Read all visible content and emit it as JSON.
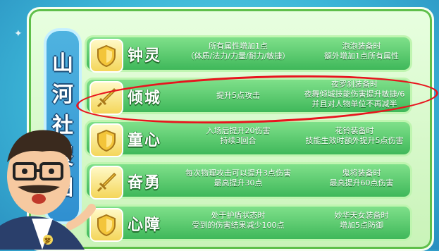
{
  "side_title": [
    "山",
    "河",
    "社",
    "稷",
    "图"
  ],
  "rows": [
    {
      "name": "钟灵",
      "icon": "shield-icon",
      "effect": [
        "所有属性增加1点",
        "（体质/法力/力量/耐力/敏捷）"
      ],
      "set_bonus": [
        "泡泡装备时",
        "额外增加1点所有属性"
      ]
    },
    {
      "name": "倾城",
      "icon": "sword-icon",
      "effect": [
        "提升5点攻击"
      ],
      "set_bonus": [
        "夜罗刹装备时",
        "夜舞倾城技能伤害提升敏捷/6",
        "并且对人物单位不再减半"
      ]
    },
    {
      "name": "童心",
      "icon": "shield-icon",
      "effect": [
        "入场后提升20伤害",
        "持续3回合"
      ],
      "set_bonus": [
        "花铃装备时",
        "技能生效时额外提升5点伤害"
      ]
    },
    {
      "name": "奋勇",
      "icon": "sword-icon",
      "effect": [
        "每次物理攻击可以提升3点伤害",
        "最高提升30点"
      ],
      "set_bonus": [
        "鬼将装备时",
        "最高提升60点伤害"
      ]
    },
    {
      "name": "心障",
      "icon": "shield-icon",
      "effect": [
        "处于护盾状态时",
        "受到的伤害结果减少100点"
      ],
      "set_bonus": [
        "妙华天女装备时",
        "增加5点防御"
      ]
    }
  ],
  "badge": "梦",
  "colors": {
    "panel": "#c9f3b8",
    "row": "#3fb85a",
    "highlight_ring": "#e8141e",
    "side_title": "#2f8fd0"
  }
}
